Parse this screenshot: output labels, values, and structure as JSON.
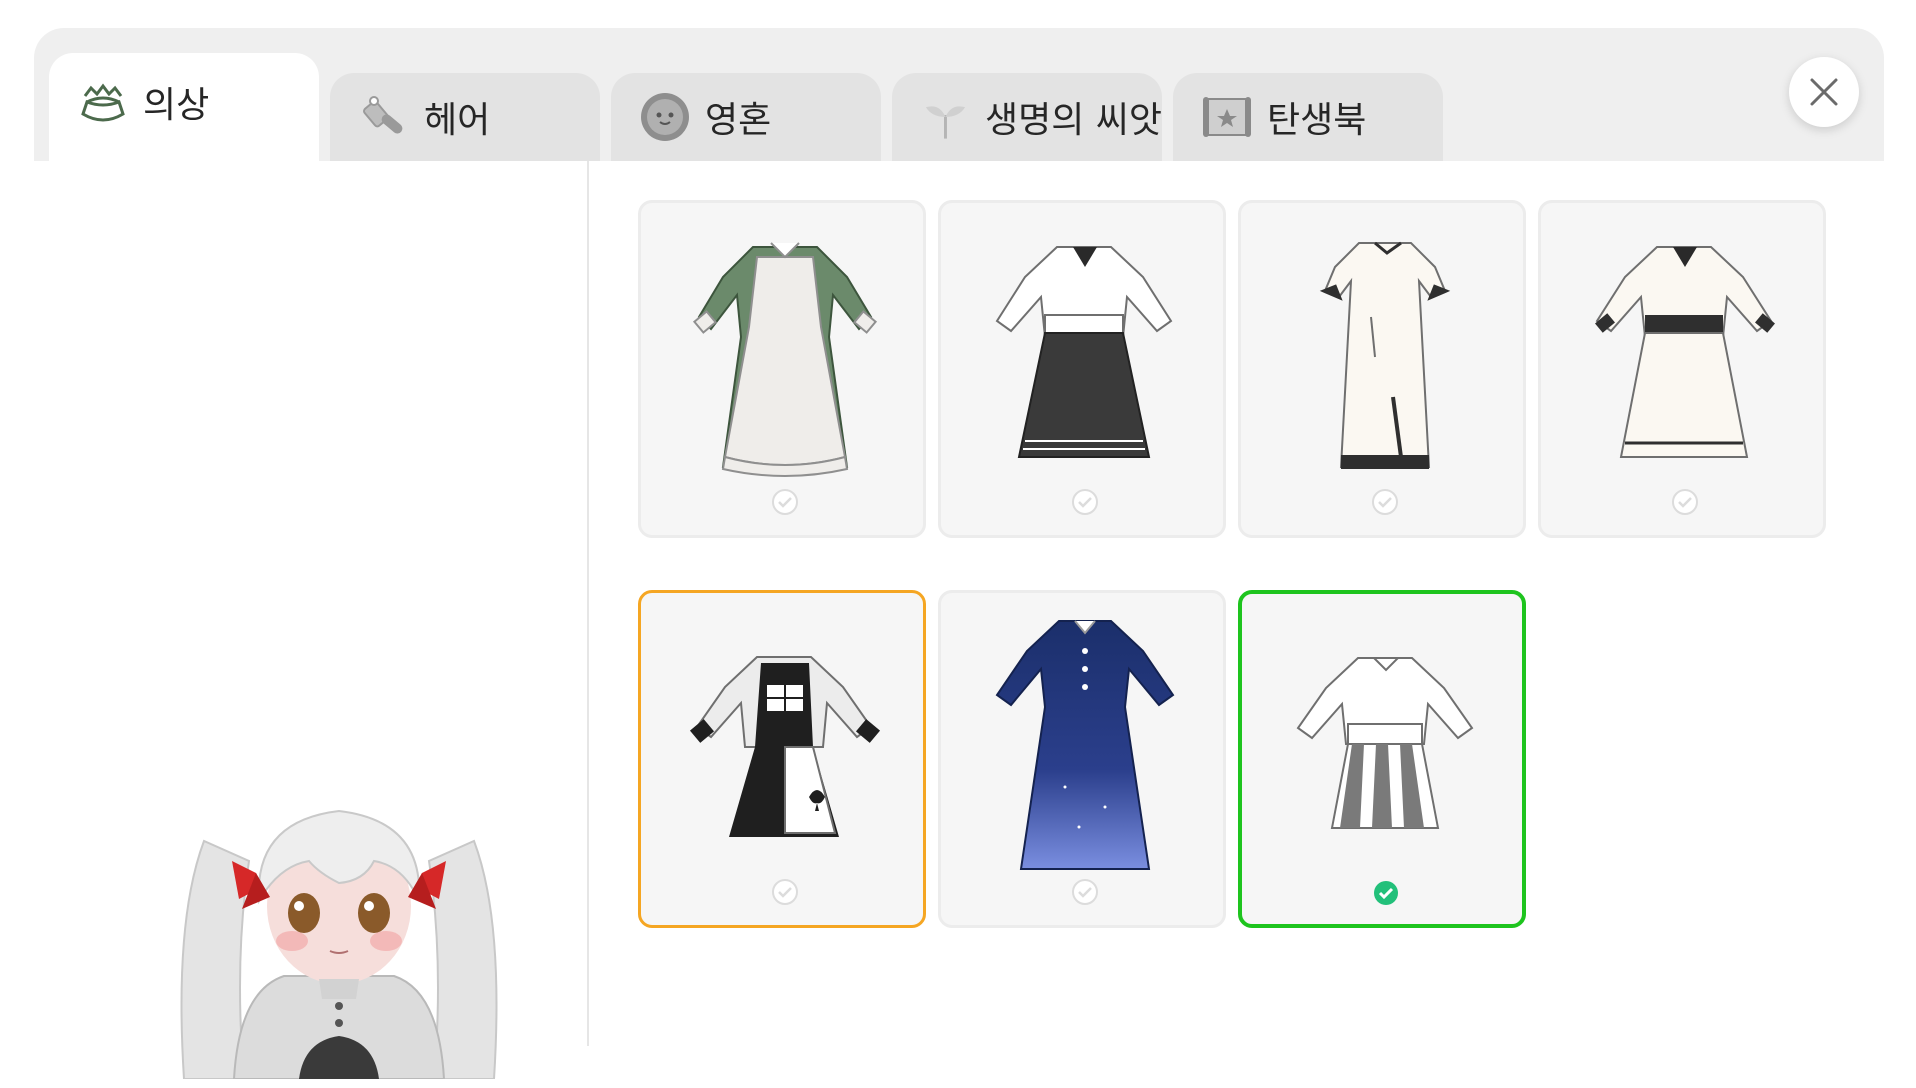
{
  "tabs": [
    {
      "id": "outfit",
      "label": "의상",
      "icon": "dress-icon",
      "active": true
    },
    {
      "id": "hair",
      "label": "헤어",
      "icon": "comb-icon",
      "active": false
    },
    {
      "id": "soul",
      "label": "영혼",
      "icon": "soul-orb-icon",
      "active": false
    },
    {
      "id": "seed",
      "label": "생명의 씨앗",
      "icon": "sprout-icon",
      "active": false
    },
    {
      "id": "birthbook",
      "label": "탄생북",
      "icon": "scroll-icon",
      "active": false
    }
  ],
  "close_icon": "close-icon",
  "outfits": [
    {
      "name": "green-maid-dress",
      "state": "normal",
      "colors": {
        "body": "#6b8a6b",
        "apron": "#efedea"
      }
    },
    {
      "name": "black-skirt-uniform",
      "state": "normal",
      "colors": {
        "top": "#ffffff",
        "skirt": "#3a3a3a"
      }
    },
    {
      "name": "white-qipao-dress",
      "state": "normal",
      "colors": {
        "body": "#fbf8f2",
        "trim": "#2f2f2f"
      }
    },
    {
      "name": "cream-long-dress",
      "state": "normal",
      "colors": {
        "body": "#fbf8f2",
        "belt": "#2f2f2f"
      }
    },
    {
      "name": "alice-spade-dress",
      "state": "hover",
      "colors": {
        "body": "#1f1f1f",
        "apron": "#ffffff"
      }
    },
    {
      "name": "starry-night-dress",
      "state": "normal",
      "colors": {
        "top": "#1b2f6b",
        "bottom": "#6f86d8"
      }
    },
    {
      "name": "heart-skirt-dress",
      "state": "selected",
      "colors": {
        "top": "#ffffff",
        "skirt": "#7a7a7a"
      }
    }
  ],
  "colors": {
    "selected_border": "#1ec41e",
    "hover_border": "#f5a623",
    "check_selected": "#22c07a",
    "check_normal": "#dcdcdc"
  }
}
